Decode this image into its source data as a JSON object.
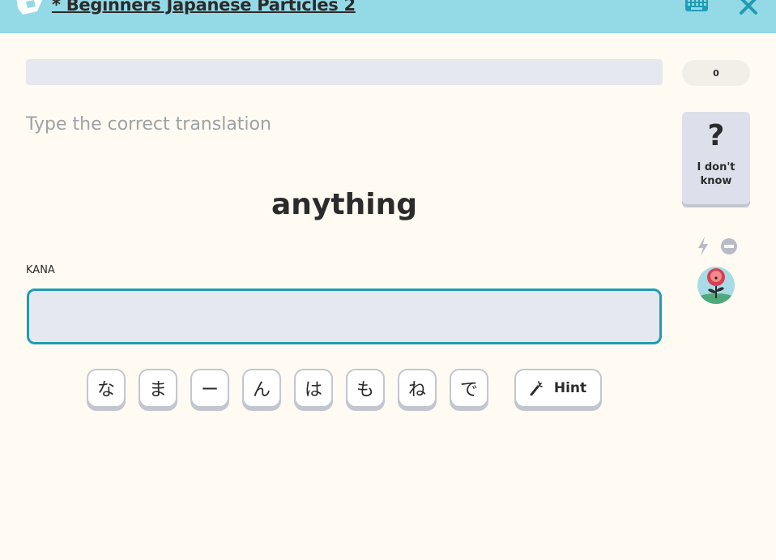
{
  "header": {
    "course_title": "* Beginners Japanese Particles 2",
    "icons": [
      "logo-icon",
      "keyboard-icon",
      "close-icon"
    ]
  },
  "session": {
    "progress_fraction": 0,
    "score": "0"
  },
  "question": {
    "prompt": "Type the correct translation",
    "word": "anything"
  },
  "answer": {
    "field_label": "KANA",
    "value": "",
    "placeholder": ""
  },
  "kana_keys": [
    "な",
    "ま",
    "ー",
    "ん",
    "は",
    "も",
    "ね",
    "で"
  ],
  "hint": {
    "label": "Hint"
  },
  "idk": {
    "symbol": "?",
    "label": "I don't know"
  },
  "colors": {
    "header_bg": "#94d9e6",
    "accent": "#1f9db3",
    "page_bg": "#fffbf2"
  }
}
